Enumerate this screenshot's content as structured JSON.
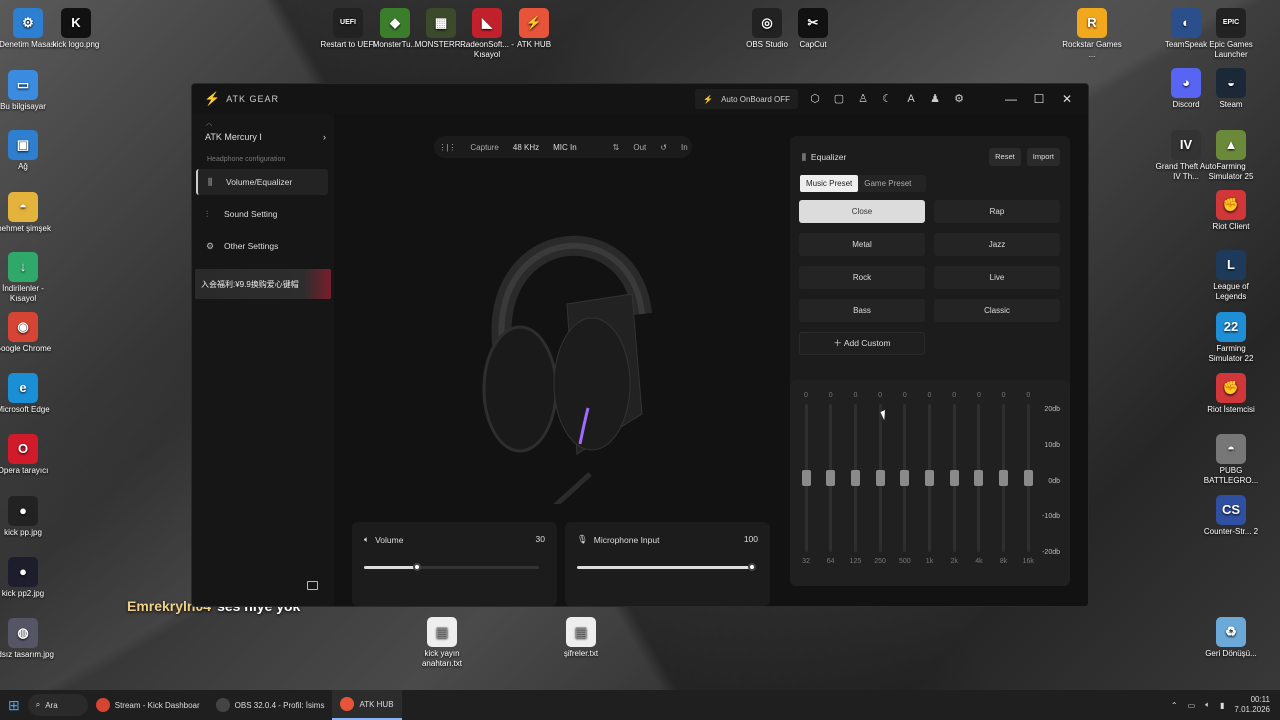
{
  "desktop_icons": [
    {
      "id": "denetim",
      "label": "Denetim Masası",
      "glyph": "⚙",
      "color": "#2d7fd1"
    },
    {
      "id": "kicklogo",
      "label": "kick logo.png",
      "glyph": "K",
      "color": "#111"
    },
    {
      "id": "bilgisayar",
      "label": "Bu bilgisayar",
      "glyph": "▭",
      "color": "#3b8be0"
    },
    {
      "id": "ag",
      "label": "Ağ",
      "glyph": "▣",
      "color": "#2f7fd0"
    },
    {
      "id": "mehmet",
      "label": "mehmet şimşek",
      "glyph": "◓",
      "color": "#e3b33b"
    },
    {
      "id": "indirilenler",
      "label": "İndirilenler - Kısayol",
      "glyph": "↓",
      "color": "#2fa86a"
    },
    {
      "id": "chrome",
      "label": "Google Chrome",
      "glyph": "◉",
      "color": "#d64434"
    },
    {
      "id": "edge",
      "label": "Microsoft Edge",
      "glyph": "e",
      "color": "#1b8fd6"
    },
    {
      "id": "opera",
      "label": "Opera tarayıcı",
      "glyph": "O",
      "color": "#d11a2a"
    },
    {
      "id": "kickpp",
      "label": "kick pp.jpg",
      "glyph": "●",
      "color": "#222"
    },
    {
      "id": "kickpp2",
      "label": "kick pp2.jpg",
      "glyph": "●",
      "color": "#1d1d2e"
    },
    {
      "id": "adsiz",
      "label": "Adsız tasarım.jpg",
      "glyph": "◍",
      "color": "#556"
    },
    {
      "id": "restart",
      "label": "Restart to UEFI",
      "glyph": "UEFI",
      "color": "#222"
    },
    {
      "id": "monstertu",
      "label": "MonsterTu...",
      "glyph": "◆",
      "color": "#3a7d2a"
    },
    {
      "id": "monsterr",
      "label": "MONSTERR...",
      "glyph": "▦",
      "color": "#3a4a2a"
    },
    {
      "id": "radeon",
      "label": "RadeonSoft... - Kısayol",
      "glyph": "◣",
      "color": "#c0212b"
    },
    {
      "id": "atkhub",
      "label": "ATK HUB",
      "glyph": "⚡",
      "color": "#e8543a"
    },
    {
      "id": "obs",
      "label": "OBS Studio",
      "glyph": "◎",
      "color": "#222"
    },
    {
      "id": "capcut",
      "label": "CapCut",
      "glyph": "✂",
      "color": "#111"
    },
    {
      "id": "rockstar",
      "label": "Rockstar Games ...",
      "glyph": "R",
      "color": "#f2a81d"
    },
    {
      "id": "teamspeak",
      "label": "TeamSpeak",
      "glyph": "◐",
      "color": "#2a4f8a"
    },
    {
      "id": "epic",
      "label": "Epic Games Launcher",
      "glyph": "EPIC",
      "color": "#222"
    },
    {
      "id": "discord",
      "label": "Discord",
      "glyph": "◕",
      "color": "#5865f2"
    },
    {
      "id": "steam",
      "label": "Steam",
      "glyph": "◒",
      "color": "#1b2838"
    },
    {
      "id": "gta",
      "label": "Grand Theft Auto IV Th...",
      "glyph": "IV",
      "color": "#333"
    },
    {
      "id": "fs25",
      "label": "Farming Simulator 25",
      "glyph": "▲",
      "color": "#6a8a3a"
    },
    {
      "id": "riot",
      "label": "Riot Client",
      "glyph": "✊",
      "color": "#d13639"
    },
    {
      "id": "lol",
      "label": "League of Legends",
      "glyph": "L",
      "color": "#1e3a5a"
    },
    {
      "id": "fs22",
      "label": "Farming Simulator 22",
      "glyph": "22",
      "color": "#1e8fd6"
    },
    {
      "id": "riotist",
      "label": "Riot İstemcisi",
      "glyph": "✊",
      "color": "#d13639"
    },
    {
      "id": "pubg",
      "label": "PUBG BATTLEGRO...",
      "glyph": "◓",
      "color": "#777"
    },
    {
      "id": "cs2",
      "label": "Counter-Str... 2",
      "glyph": "CS",
      "color": "#2f4fa0"
    },
    {
      "id": "geri",
      "label": "Geri Dönüşü...",
      "glyph": "♻",
      "color": "#6aa9d8"
    },
    {
      "id": "kickyayin",
      "label": "kick yayın anahtarı.txt",
      "glyph": "▤",
      "color": "#eee"
    },
    {
      "id": "sifreler",
      "label": "şifreler.txt",
      "glyph": "▤",
      "color": "#eee"
    }
  ],
  "chat": {
    "user": "Emrekryln04",
    "message": "ses niye yok"
  },
  "app": {
    "brand": "ATK GEAR",
    "onboard": "Auto OnBoard OFF",
    "device": "ATK Mercury I",
    "section_label": "Headphone configuration",
    "nav": [
      {
        "label": "Volume/Equalizer",
        "icon": "sliders-icon",
        "active": true
      },
      {
        "label": "Sound Setting",
        "icon": "tune-icon",
        "active": false
      },
      {
        "label": "Other Settings",
        "icon": "gear-icon",
        "active": false
      }
    ],
    "promo": "入会福利:¥9.9换购爱心键帽",
    "capture": {
      "label": "Capture",
      "rate": "48 KHz",
      "mic": "MIC In",
      "out": "Out",
      "in": "In"
    },
    "volume": {
      "label": "Volume",
      "value": "30",
      "level": 0.3
    },
    "mic": {
      "label": "Microphone Input",
      "value": "100",
      "level": 1.0
    },
    "eq": {
      "title": "Equalizer",
      "reset": "Reset",
      "import": "Import",
      "tabs": [
        "Music Preset",
        "Game Preset"
      ],
      "presets": [
        "Close",
        "Rap",
        "Metal",
        "Jazz",
        "Rock",
        "Live",
        "Bass",
        "Classic"
      ],
      "add_custom": "Add Custom",
      "bands": [
        {
          "f": "32",
          "v": "0"
        },
        {
          "f": "64",
          "v": "0"
        },
        {
          "f": "125",
          "v": "0"
        },
        {
          "f": "250",
          "v": "0"
        },
        {
          "f": "500",
          "v": "0"
        },
        {
          "f": "1k",
          "v": "0"
        },
        {
          "f": "2k",
          "v": "0"
        },
        {
          "f": "4k",
          "v": "0"
        },
        {
          "f": "8k",
          "v": "0"
        },
        {
          "f": "16k",
          "v": "0"
        }
      ],
      "db_labels": [
        "20db",
        "10db",
        "0db",
        "-10db",
        "-20db"
      ]
    }
  },
  "taskbar": {
    "search": "Ara",
    "items": [
      {
        "label": "Stream - Kick Dashboar",
        "color": "#d64434",
        "active": false
      },
      {
        "label": "OBS 32.0.4 - Profil: İsims",
        "color": "#444",
        "active": false
      },
      {
        "label": "ATK HUB",
        "color": "#e8543a",
        "active": true
      }
    ],
    "time": "00:11",
    "date": "7.01.2026"
  }
}
